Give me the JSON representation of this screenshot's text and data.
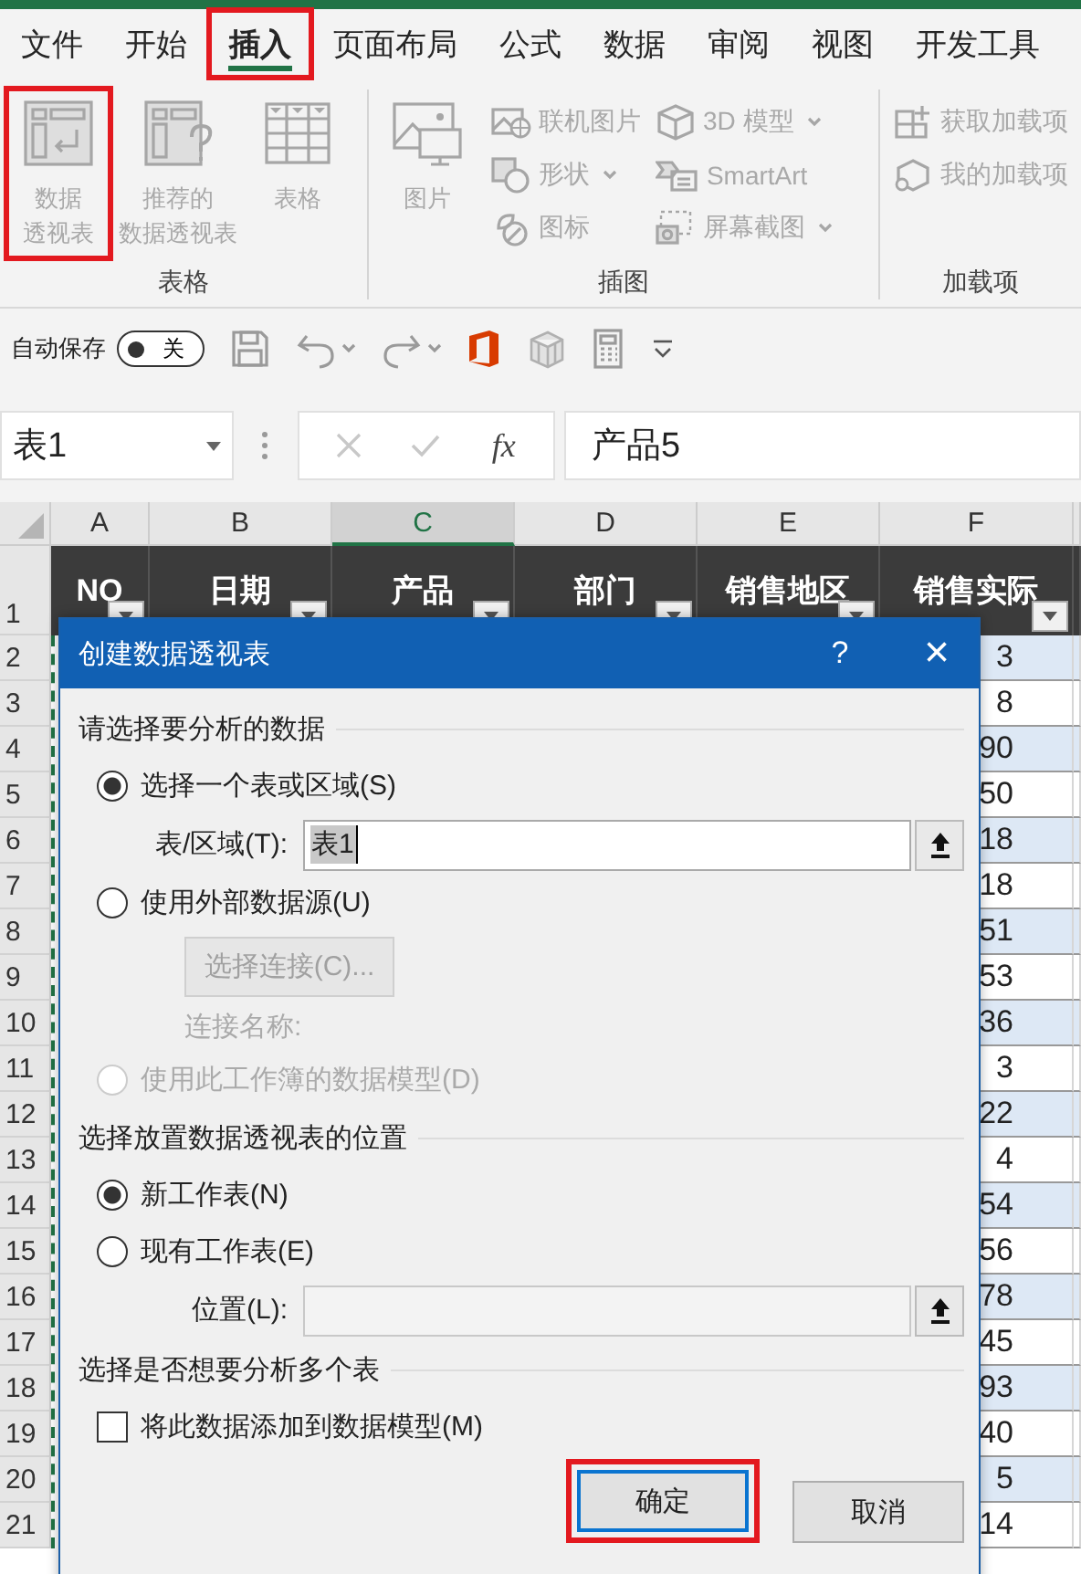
{
  "tabs": [
    {
      "label": "文件",
      "selected": false,
      "highlighted": false
    },
    {
      "label": "开始",
      "selected": false,
      "highlighted": false
    },
    {
      "label": "插入",
      "selected": true,
      "highlighted": true
    },
    {
      "label": "页面布局",
      "selected": false,
      "highlighted": false
    },
    {
      "label": "公式",
      "selected": false,
      "highlighted": false
    },
    {
      "label": "数据",
      "selected": false,
      "highlighted": false
    },
    {
      "label": "审阅",
      "selected": false,
      "highlighted": false
    },
    {
      "label": "视图",
      "selected": false,
      "highlighted": false
    },
    {
      "label": "开发工具",
      "selected": false,
      "highlighted": false
    }
  ],
  "ribbon": {
    "groups": [
      {
        "label": "表格",
        "items": [
          {
            "kind": "large",
            "lines": [
              "数据",
              "透视表"
            ],
            "disabled": true,
            "highlighted": true
          },
          {
            "kind": "large",
            "lines": [
              "推荐的",
              "数据透视表"
            ],
            "disabled": true,
            "highlighted": false
          },
          {
            "kind": "large",
            "lines": [
              "表格"
            ],
            "disabled": true,
            "highlighted": false
          }
        ]
      },
      {
        "label": "插图",
        "items": [
          {
            "kind": "large",
            "lines": [
              "图片"
            ],
            "disabled": true,
            "highlighted": false
          },
          {
            "kind": "small",
            "label": "联机图片",
            "dropdown": false,
            "disabled": true
          },
          {
            "kind": "small",
            "label": "形状",
            "dropdown": true,
            "disabled": true
          },
          {
            "kind": "small",
            "label": "图标",
            "dropdown": false,
            "disabled": true
          },
          {
            "kind": "small",
            "label": "3D 模型",
            "dropdown": true,
            "disabled": true
          },
          {
            "kind": "small",
            "label": "SmartArt",
            "dropdown": false,
            "disabled": true
          },
          {
            "kind": "small",
            "label": "屏幕截图",
            "dropdown": true,
            "disabled": true
          }
        ]
      },
      {
        "label": "加载项",
        "items": [
          {
            "kind": "small",
            "label": "获取加载项",
            "dropdown": false,
            "disabled": true
          },
          {
            "kind": "small",
            "label": "我的加载项",
            "dropdown": false,
            "disabled": true
          }
        ]
      }
    ]
  },
  "quick_access": {
    "autosave": {
      "label": "自动保存",
      "state": "关",
      "on": false
    }
  },
  "formula_bar": {
    "name_box": "表1",
    "function_label": "fx",
    "value": "产品5"
  },
  "columns": [
    {
      "label": "A",
      "selected": false
    },
    {
      "label": "B",
      "selected": false
    },
    {
      "label": "C",
      "selected": true
    },
    {
      "label": "D",
      "selected": false
    },
    {
      "label": "E",
      "selected": false
    },
    {
      "label": "F",
      "selected": false
    }
  ],
  "header_row": {
    "number": "1",
    "cells": [
      "NO",
      "日期",
      "产品",
      "部门",
      "销售地区",
      "销售实际"
    ]
  },
  "rows": [
    {
      "number": "2",
      "column_f": "3"
    },
    {
      "number": "3",
      "column_f": "8"
    },
    {
      "number": "4",
      "column_f": "90"
    },
    {
      "number": "5",
      "column_f": "50"
    },
    {
      "number": "6",
      "column_f": "18"
    },
    {
      "number": "7",
      "column_f": "18"
    },
    {
      "number": "8",
      "column_f": "51"
    },
    {
      "number": "9",
      "column_f": "53"
    },
    {
      "number": "10",
      "column_f": "36"
    },
    {
      "number": "11",
      "column_f": "3"
    },
    {
      "number": "12",
      "column_f": "22"
    },
    {
      "number": "13",
      "column_f": "4"
    },
    {
      "number": "14",
      "column_f": "54"
    },
    {
      "number": "15",
      "column_f": "56"
    },
    {
      "number": "16",
      "column_f": "78"
    },
    {
      "number": "17",
      "column_f": "45"
    },
    {
      "number": "18",
      "column_f": "93"
    },
    {
      "number": "19",
      "column_f": "40"
    },
    {
      "number": "20",
      "column_f": "5"
    },
    {
      "number": "21",
      "column_f": "14"
    }
  ],
  "dialog": {
    "title": "创建数据透视表",
    "help": "?",
    "close": "×",
    "sections": [
      {
        "title": "请选择要分析的数据",
        "items": [
          {
            "kind": "radio",
            "label": "选择一个表或区域(S)",
            "selected": true,
            "disabled": false
          },
          {
            "kind": "field",
            "label": "表/区域(T):",
            "value": "表1",
            "value_selected": true,
            "disabled": false
          },
          {
            "kind": "radio",
            "label": "使用外部数据源(U)",
            "selected": false,
            "disabled": false
          },
          {
            "kind": "button",
            "label": "选择连接(C)...",
            "disabled": true
          },
          {
            "kind": "note",
            "label": "连接名称:",
            "disabled": true
          },
          {
            "kind": "radio",
            "label": "使用此工作簿的数据模型(D)",
            "selected": false,
            "disabled": true
          }
        ]
      },
      {
        "title": "选择放置数据透视表的位置",
        "items": [
          {
            "kind": "radio",
            "label": "新工作表(N)",
            "selected": true,
            "disabled": false
          },
          {
            "kind": "radio",
            "label": "现有工作表(E)",
            "selected": false,
            "disabled": false
          },
          {
            "kind": "field",
            "label": "位置(L):",
            "disabled": true
          }
        ]
      },
      {
        "title": "选择是否想要分析多个表",
        "items": [
          {
            "kind": "checkbox",
            "label": "将此数据添加到数据模型(M)",
            "checked": false,
            "disabled": false
          }
        ]
      }
    ],
    "buttons": [
      {
        "label": "确定",
        "default": true,
        "highlighted": true
      },
      {
        "label": "取消",
        "default": false,
        "highlighted": false
      }
    ]
  }
}
